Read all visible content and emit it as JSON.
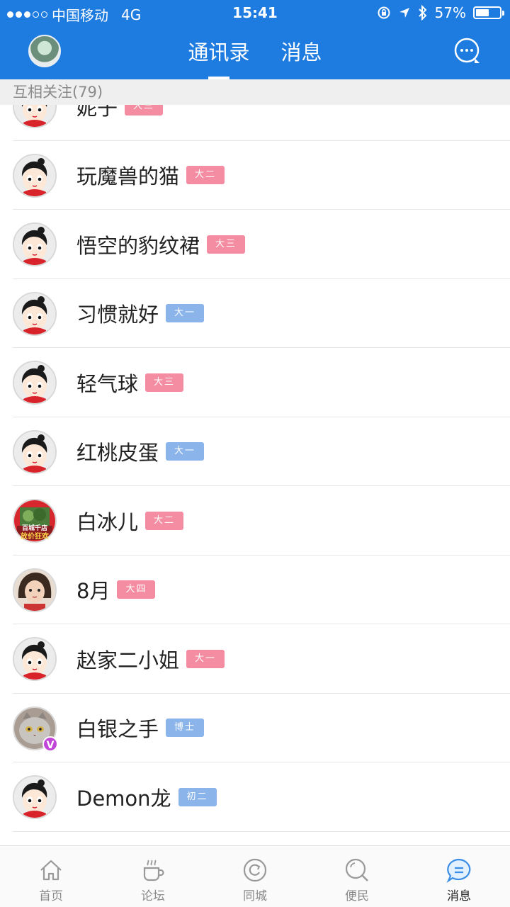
{
  "status": {
    "carrier": "中国移动",
    "network": "4G",
    "time": "15:41",
    "battery": "57%",
    "battery_level": 0.57
  },
  "nav": {
    "tabs": [
      "通讯录",
      "消息"
    ],
    "active_tab": 0
  },
  "section": {
    "title": "互相关注(79)"
  },
  "contacts": [
    {
      "name": "妮子",
      "grade": "大三",
      "color": "pink",
      "avatar": "cartoon"
    },
    {
      "name": "玩魔兽的猫",
      "grade": "大二",
      "color": "pink",
      "avatar": "cartoon"
    },
    {
      "name": "悟空的豹纹裙",
      "grade": "大三",
      "color": "pink",
      "avatar": "cartoon"
    },
    {
      "name": "习惯就好",
      "grade": "大一",
      "color": "blue",
      "avatar": "cartoon"
    },
    {
      "name": "轻气球",
      "grade": "大三",
      "color": "pink",
      "avatar": "cartoon"
    },
    {
      "name": "红桃皮蛋",
      "grade": "大一",
      "color": "blue",
      "avatar": "cartoon"
    },
    {
      "name": "白冰儿",
      "grade": "大二",
      "color": "pink",
      "avatar": "shop",
      "avatar_text": [
        "百城千店",
        "放价狂欢"
      ]
    },
    {
      "name": "8月",
      "grade": "大四",
      "color": "pink",
      "avatar": "child"
    },
    {
      "name": "赵家二小姐",
      "grade": "大一",
      "color": "pink",
      "avatar": "cartoon"
    },
    {
      "name": "白银之手",
      "grade": "博士",
      "color": "blue",
      "avatar": "cat",
      "verified": "V"
    },
    {
      "name": "Demon龙",
      "grade": "初二",
      "color": "blue",
      "avatar": "cartoon"
    }
  ],
  "tabbar": {
    "items": [
      {
        "label": "首页",
        "icon": "home-icon"
      },
      {
        "label": "论坛",
        "icon": "coffee-icon"
      },
      {
        "label": "同城",
        "icon": "refresh-icon"
      },
      {
        "label": "便民",
        "icon": "search-icon"
      },
      {
        "label": "消息",
        "icon": "message-icon"
      }
    ],
    "active": 4
  },
  "colors": {
    "primary": "#1e7ce0",
    "badge_pink": "#f48ca2",
    "badge_blue": "#8ab4ea",
    "active_icon": "#3a8ee6"
  }
}
